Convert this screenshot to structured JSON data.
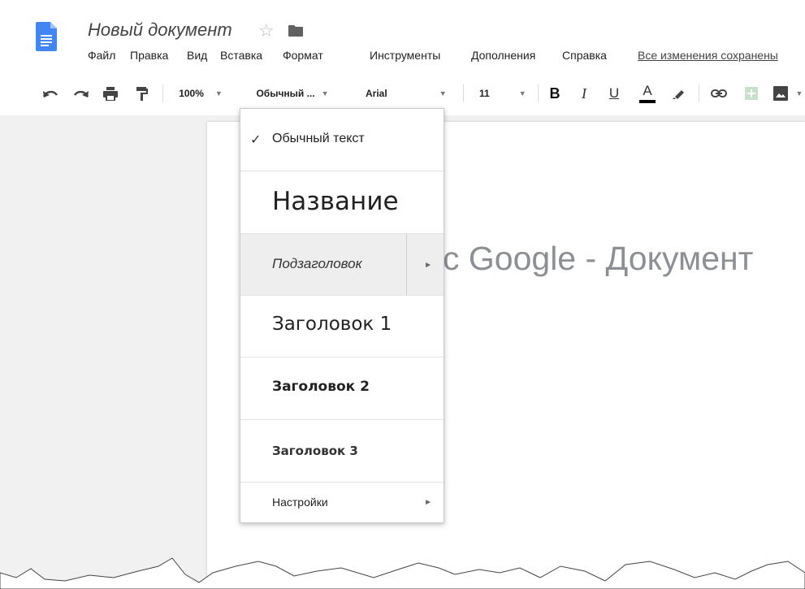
{
  "doc": {
    "title": "Новый документ",
    "star_glyph": "☆"
  },
  "menu": {
    "items": [
      "Файл",
      "Правка",
      "Вид",
      "Вставка",
      "Формат",
      "Инструменты",
      "Дополнения",
      "Справка"
    ],
    "saved_status": "Все изменения сохранены"
  },
  "toolbar": {
    "zoom": "100%",
    "style": "Обычный ...",
    "font": "Arial",
    "font_size": "11",
    "bold": "B",
    "italic": "I",
    "underline": "U",
    "text_color": "A",
    "icons": [
      "undo-icon",
      "redo-icon",
      "print-icon",
      "paint-format-icon",
      "highlight-icon",
      "link-icon",
      "comment-icon",
      "image-icon"
    ]
  },
  "page": {
    "visible_text": "с Google - Документ"
  },
  "style_menu": {
    "items": [
      {
        "label": "Обычный текст",
        "checked": true
      },
      {
        "label": "Название"
      },
      {
        "label": "Подзаголовок",
        "has_submenu": true,
        "hovered": true
      },
      {
        "label": "Заголовок 1"
      },
      {
        "label": "Заголовок 2"
      },
      {
        "label": "Заголовок 3"
      },
      {
        "label": "Настройки",
        "has_submenu": true
      }
    ],
    "check_glyph": "✓",
    "submenu_glyph": "►"
  },
  "colors": {
    "docs_blue": "#4285f4",
    "page_text_gray": "#8c9095",
    "hover_bg": "#eeeeee"
  }
}
